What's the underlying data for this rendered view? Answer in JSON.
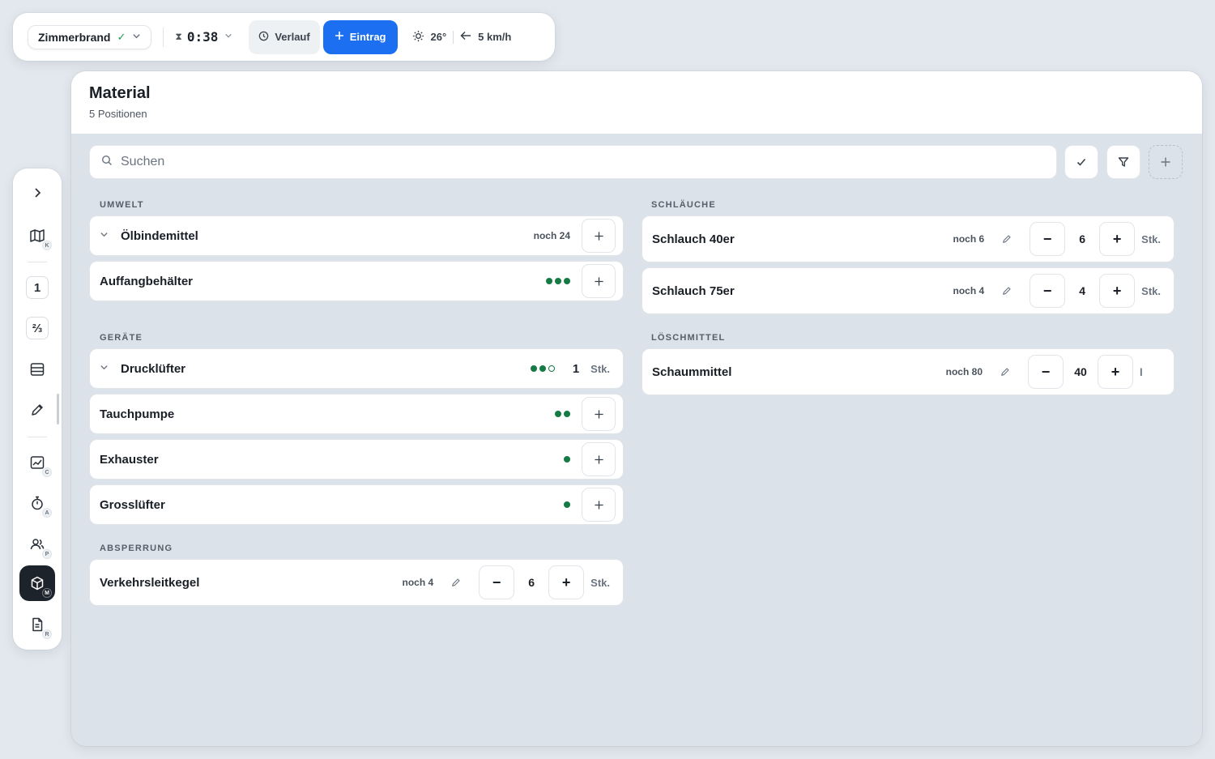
{
  "topbar": {
    "incident": "Zimmerbrand",
    "timer": "0:38",
    "verlauf": "Verlauf",
    "eintrag": "Eintrag",
    "temperature": "26°",
    "wind": "5 km/h"
  },
  "sidebar": {
    "items": [
      {
        "icon": "chevron-right-icon"
      },
      {
        "icon": "map-icon",
        "shortcut": "K"
      },
      {
        "label": "1"
      },
      {
        "label": "⅔"
      },
      {
        "icon": "table-icon"
      },
      {
        "icon": "pencil-icon"
      },
      {
        "icon": "chart-icon",
        "shortcut": "C"
      },
      {
        "icon": "stopwatch-icon",
        "shortcut": "A"
      },
      {
        "icon": "people-icon",
        "shortcut": "P"
      },
      {
        "icon": "package-icon",
        "shortcut": "M",
        "active": true
      },
      {
        "icon": "document-icon",
        "shortcut": "R"
      }
    ]
  },
  "panel": {
    "title": "Material",
    "subtitle": "5 Positionen",
    "search_placeholder": "Suchen"
  },
  "sections": {
    "umwelt": "UMWELT",
    "geraete": "GERÄTE",
    "absperrung": "ABSPERRUNG",
    "schlaeuche": "SCHLÄUCHE",
    "loeschmittel": "LÖSCHMITTEL"
  },
  "items": {
    "oelbindemittel": {
      "name": "Ölbindemittel",
      "noch": "noch 24"
    },
    "auffangbehaelter": {
      "name": "Auffangbehälter",
      "dots_filled": 3,
      "dots_total": 3
    },
    "druckluefter": {
      "name": "Drucklüfter",
      "dots_filled": 2,
      "dots_total": 3,
      "qty": "1",
      "unit": "Stk."
    },
    "tauchpumpe": {
      "name": "Tauchpumpe",
      "dots_filled": 2,
      "dots_total": 2
    },
    "exhauster": {
      "name": "Exhauster",
      "dots_filled": 1,
      "dots_total": 1
    },
    "grossluefter": {
      "name": "Grosslüfter",
      "dots_filled": 1,
      "dots_total": 1
    },
    "verkehrsleitkegel": {
      "name": "Verkehrsleitkegel",
      "noch": "noch 4",
      "value": "6",
      "unit": "Stk."
    },
    "schlauch40": {
      "name": "Schlauch 40er",
      "noch": "noch 6",
      "value": "6",
      "unit": "Stk."
    },
    "schlauch75": {
      "name": "Schlauch 75er",
      "noch": "noch 4",
      "value": "4",
      "unit": "Stk."
    },
    "schaummittel": {
      "name": "Schaummittel",
      "noch": "noch 80",
      "value": "40",
      "unit": "l"
    }
  },
  "colors": {
    "accent": "#1d6ff2",
    "status_green": "#167a45",
    "active_nav": "#1d232b"
  }
}
